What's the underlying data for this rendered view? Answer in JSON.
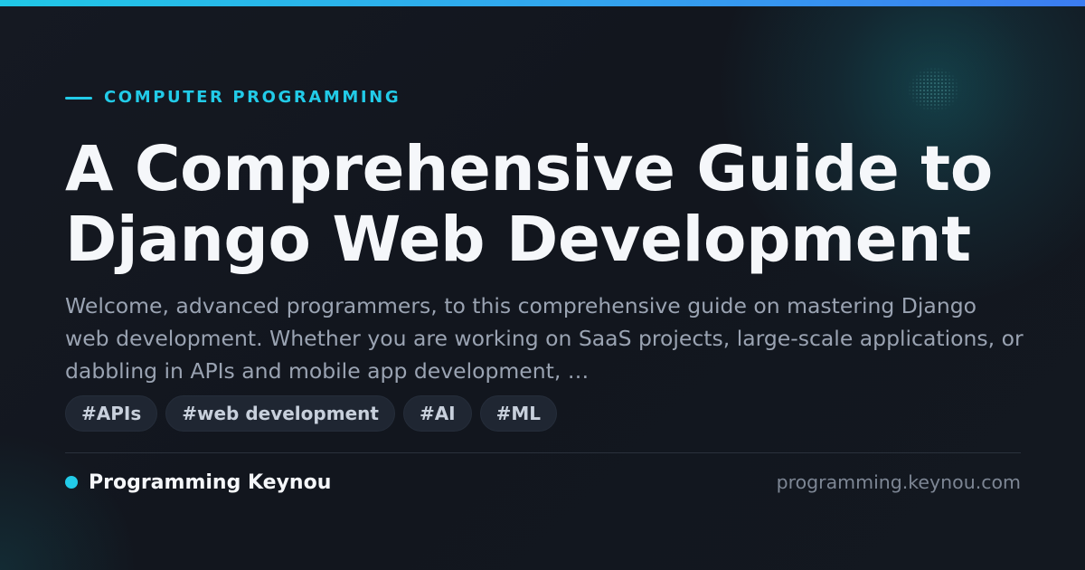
{
  "card": {
    "category": "COMPUTER PROGRAMMING",
    "title": "A Comprehensive Guide to Django Web Development",
    "excerpt": "Welcome, advanced programmers, to this comprehensive guide on mastering Django web development. Whether you are working on SaaS projects, large-scale applications, or dabbling in APIs and mobile app development, …",
    "tags": [
      "#APIs",
      "#web development",
      "#AI",
      "#ML"
    ],
    "brand": "Programming Keynou",
    "domain": "programming.keynou.com"
  },
  "colors": {
    "accent": "#22cbe8",
    "gradient_bar_start": "#20c7e6",
    "gradient_bar_end": "#3b7cf1",
    "background": "#131820",
    "title": "#f5f7fa",
    "excerpt": "#9aa3b2",
    "tag_background": "#1f2632",
    "tag_text": "#c8d0dc",
    "domain_text": "#7d8694"
  }
}
